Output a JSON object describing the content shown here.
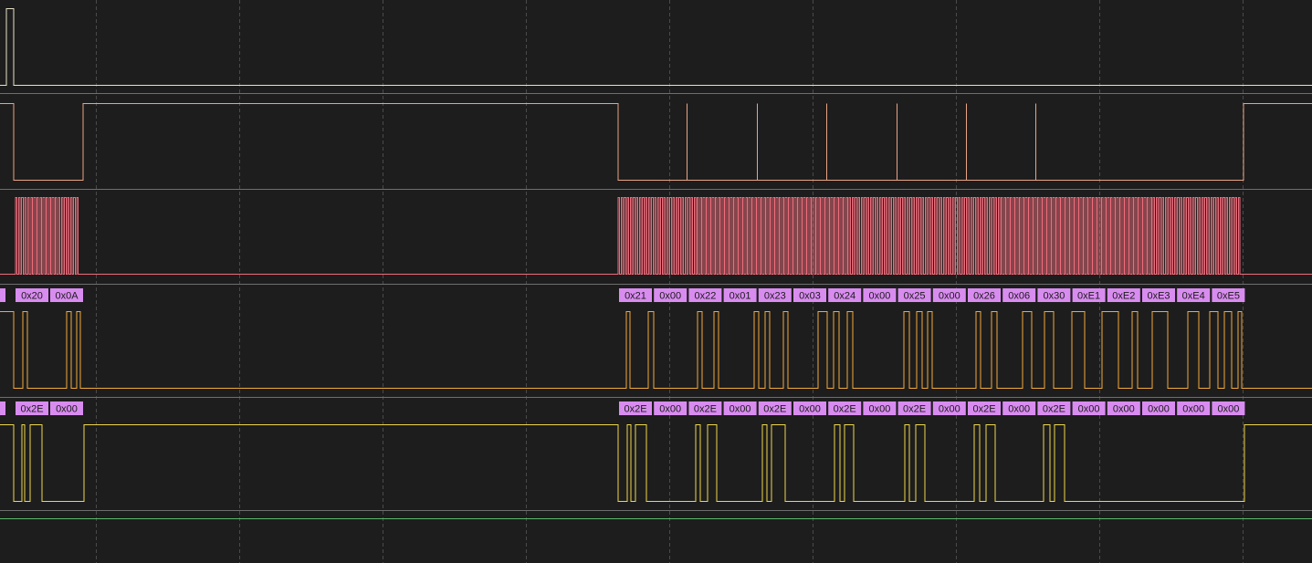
{
  "colors": {
    "background": "#1d1d1d",
    "grid": "#4a4a4a",
    "channel_separator": "#6e6e6e",
    "decode_box": "#d98cf0",
    "decode_text": "#1a1a1a"
  },
  "channels": [
    {
      "id": "ch0",
      "color": "#e8e2c8"
    },
    {
      "id": "ch1",
      "color": "#e9a483"
    },
    {
      "id": "ch2",
      "color": "#ef6d7c"
    },
    {
      "id": "ch3",
      "color": "#f2a93b"
    },
    {
      "id": "ch4",
      "color": "#eed64a"
    },
    {
      "id": "ch5",
      "color": "#5bb86b"
    }
  ],
  "decoders": [
    {
      "id": "miso",
      "bytes": [
        "",
        "0x20",
        "0x0A",
        "0x21",
        "0x00",
        "0x22",
        "0x01",
        "0x23",
        "0x03",
        "0x24",
        "0x00",
        "0x25",
        "0x00",
        "0x26",
        "0x06",
        "0x30",
        "0xE1",
        "0xE2",
        "0xE3",
        "0xE4",
        "0xE5"
      ]
    },
    {
      "id": "mosi",
      "bytes": [
        "",
        "0x2E",
        "0x00",
        "0x2E",
        "0x00",
        "0x2E",
        "0x00",
        "0x2E",
        "0x00",
        "0x2E",
        "0x00",
        "0x2E",
        "0x00",
        "0x2E",
        "0x00",
        "0x2E",
        "0x00",
        "0x00",
        "0x00",
        "0x00",
        "0x00"
      ]
    }
  ]
}
